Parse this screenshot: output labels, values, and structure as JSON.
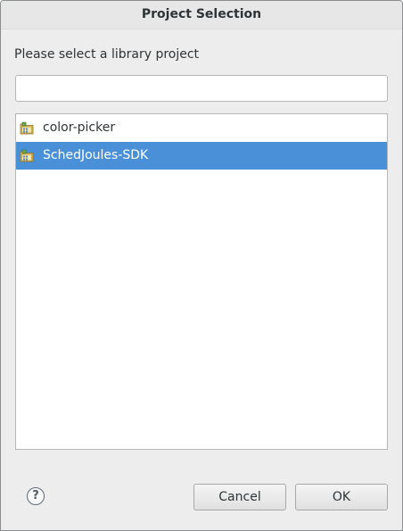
{
  "window": {
    "title": "Project Selection"
  },
  "prompt": "Please select a library project",
  "filter": {
    "value": "",
    "placeholder": ""
  },
  "projects": [
    {
      "label": "color-picker",
      "icon": "android-library-project-icon",
      "selected": false
    },
    {
      "label": "SchedJoules-SDK",
      "icon": "android-library-project-icon",
      "selected": true
    }
  ],
  "buttons": {
    "help": "?",
    "cancel": "Cancel",
    "ok": "OK"
  },
  "colors": {
    "selection": "#4a90d9",
    "dialog_bg": "#ededed",
    "list_bg": "#ffffff"
  }
}
